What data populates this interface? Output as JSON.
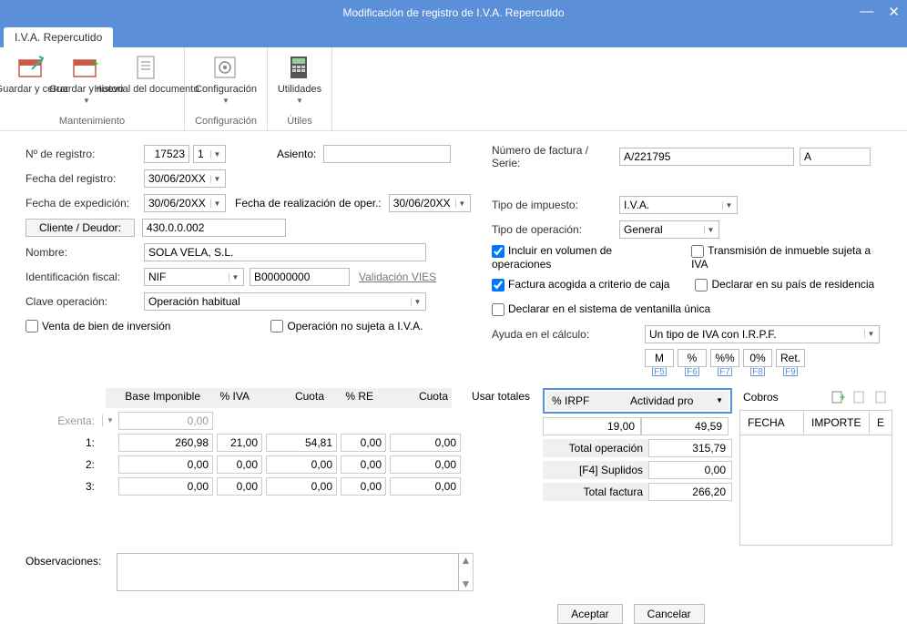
{
  "title": "Modificación de registro de I.V.A. Repercutido",
  "tab": "I.V.A. Repercutido",
  "ribbon": {
    "guardar_cerrar": "Guardar y cerrar",
    "guardar_nuevo": "Guardar y nuevo",
    "historial": "Historial del documento",
    "g1": "Mantenimiento",
    "config": "Configuración",
    "g2": "Configuración",
    "utilidades": "Utilidades",
    "g3": "Útiles"
  },
  "form": {
    "n_registro": "Nº de registro:",
    "n_registro_v": "17523",
    "n_registro_s": "1",
    "asiento": "Asiento:",
    "fecha_reg": "Fecha del registro:",
    "fecha_reg_v": "30/06/20XX",
    "fecha_exp": "Fecha de expedición:",
    "fecha_exp_v": "30/06/20XX",
    "fecha_oper": "Fecha de realización de oper.:",
    "fecha_oper_v": "30/06/20XX",
    "cliente_btn": "Cliente / Deudor:",
    "cliente_v": "430.0.0.002",
    "nombre": "Nombre:",
    "nombre_v": "SOLA VELA, S.L.",
    "id_fiscal": "Identificación fiscal:",
    "id_tipo": "NIF",
    "id_num": "B00000000",
    "validacion": "Validación VIES",
    "clave": "Clave operación:",
    "clave_v": "Operación habitual",
    "venta_bien": "Venta de bien de inversión",
    "op_no_sujeta": "Operación no sujeta a I.V.A.",
    "num_factura": "Número de factura / Serie:",
    "num_factura_v": "A/221795",
    "serie_v": "A",
    "tipo_imp": "Tipo de impuesto:",
    "tipo_imp_v": "I.V.A.",
    "tipo_op": "Tipo de operación:",
    "tipo_op_v": "General",
    "incluir": "Incluir en volumen de operaciones",
    "transmision": "Transmisión de inmueble sujeta a IVA",
    "acogida": "Factura acogida a criterio de caja",
    "declarar_pais": "Declarar en su país de residencia",
    "ventanilla": "Declarar en el sistema de ventanilla única",
    "ayuda": "Ayuda en el cálculo:",
    "ayuda_v": "Un tipo de IVA con I.R.P.F.",
    "M": "M",
    "pct": "%",
    "pctpct": "%%",
    "zero": "0%",
    "ret": "Ret.",
    "F5": "[F5]",
    "F6": "[F6]",
    "F7": "[F7]",
    "F8": "[F8]",
    "F9": "[F9]"
  },
  "grid": {
    "h_base": "Base Imponible",
    "h_iva": "% IVA",
    "h_cuota": "Cuota",
    "h_re": "% RE",
    "h_cuota2": "Cuota",
    "usar_totales": "Usar totales",
    "exenta": "Exenta:",
    "r1": "1:",
    "r2": "2:",
    "r3": "3:",
    "v_exenta": "0,00",
    "v1": [
      "260,98",
      "21,00",
      "54,81",
      "0,00",
      "0,00"
    ],
    "v2": [
      "0,00",
      "0,00",
      "0,00",
      "0,00",
      "0,00"
    ],
    "v3": [
      "0,00",
      "0,00",
      "0,00",
      "0,00",
      "0,00"
    ]
  },
  "irpf": {
    "pct": "% IRPF",
    "act": "Actividad pro",
    "v_pct": "19,00",
    "v_imp": "49,59",
    "total_op": "Total operación",
    "total_op_v": "315,79",
    "suplidos": "[F4] Suplidos",
    "suplidos_v": "0,00",
    "total_fac": "Total factura",
    "total_fac_v": "266,20"
  },
  "cobros": {
    "title": "Cobros",
    "fecha": "FECHA",
    "importe": "IMPORTE",
    "e": "E"
  },
  "obs": "Observaciones:",
  "aceptar": "Aceptar",
  "cancelar": "Cancelar"
}
